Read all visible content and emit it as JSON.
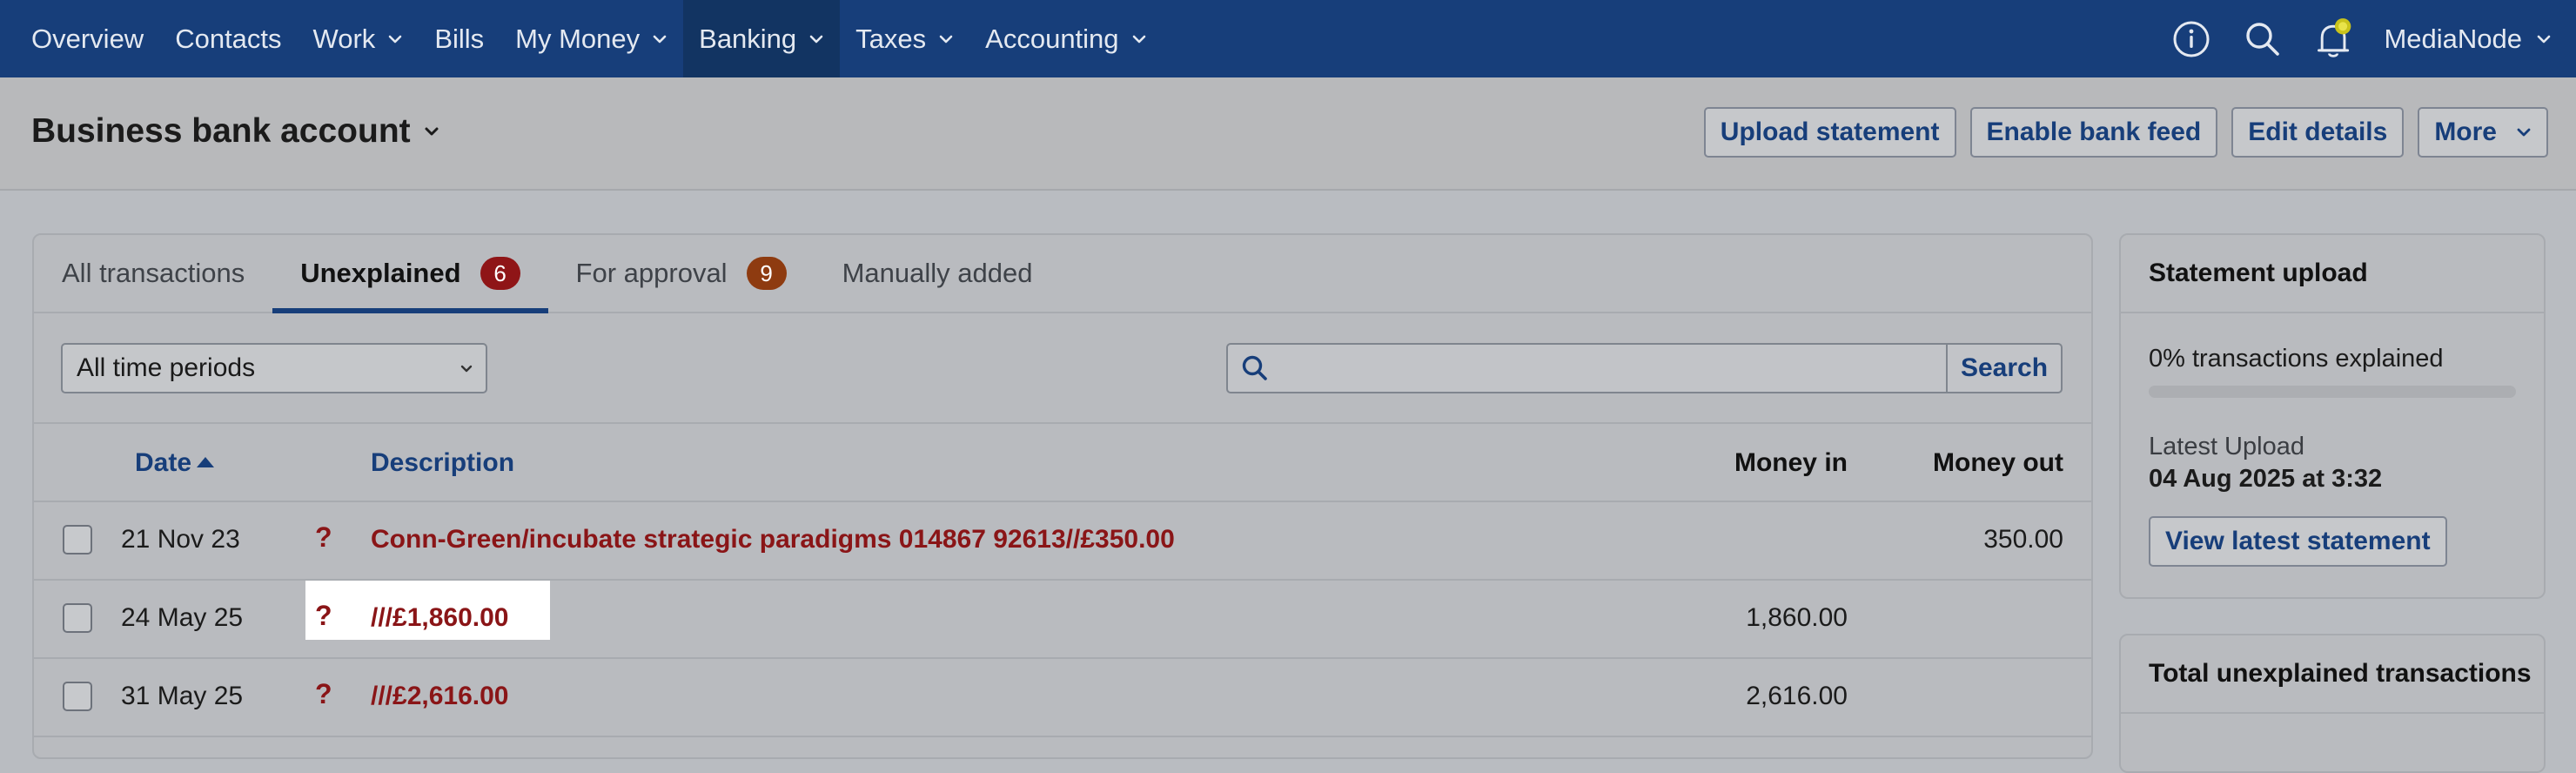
{
  "nav": {
    "items": [
      {
        "label": "Overview",
        "dropdown": false,
        "active": false
      },
      {
        "label": "Contacts",
        "dropdown": false,
        "active": false
      },
      {
        "label": "Work",
        "dropdown": true,
        "active": false
      },
      {
        "label": "Bills",
        "dropdown": false,
        "active": false
      },
      {
        "label": "My Money",
        "dropdown": true,
        "active": false
      },
      {
        "label": "Banking",
        "dropdown": true,
        "active": true
      },
      {
        "label": "Taxes",
        "dropdown": true,
        "active": false
      },
      {
        "label": "Accounting",
        "dropdown": true,
        "active": false
      }
    ],
    "account_label": "MediaNode",
    "icons": [
      "info-icon",
      "search-icon",
      "bell-icon"
    ]
  },
  "header": {
    "title": "Business bank account",
    "actions": {
      "upload": "Upload statement",
      "feed": "Enable bank feed",
      "edit": "Edit details",
      "more": "More"
    }
  },
  "tabs": [
    {
      "label": "All transactions",
      "badge": ""
    },
    {
      "label": "Unexplained",
      "badge": "6"
    },
    {
      "label": "For approval",
      "badge": "9"
    },
    {
      "label": "Manually added",
      "badge": ""
    }
  ],
  "filters": {
    "period": "All time periods",
    "search_value": "",
    "search_button": "Search"
  },
  "table": {
    "columns": {
      "date": "Date",
      "description": "Description",
      "money_in": "Money in",
      "money_out": "Money out"
    },
    "rows": [
      {
        "date": "21 Nov 23",
        "flag": "?",
        "description": "Conn-Green/incubate strategic paradigms 014867 92613//£350.00",
        "money_in": "",
        "money_out": "350.00"
      },
      {
        "date": "24 May 25",
        "flag": "?",
        "description": "///£1,860.00",
        "money_in": "1,860.00",
        "money_out": ""
      },
      {
        "date": "31 May 25",
        "flag": "?",
        "description": "///£2,616.00",
        "money_in": "2,616.00",
        "money_out": ""
      }
    ]
  },
  "statement": {
    "title": "Statement upload",
    "explained_text": "0% transactions explained",
    "explained_fraction": 0,
    "latest_label": "Latest Upload",
    "latest_value": "04 Aug 2025 at 3:32",
    "view_button": "View latest statement"
  },
  "totals": {
    "title": "Total unexplained transactions"
  },
  "colors": {
    "nav_bg": "#173e7a",
    "accent": "#173e7a",
    "alert_text": "#8a1517",
    "badge_red": "#8f1517",
    "badge_orange": "#8e3b10"
  }
}
